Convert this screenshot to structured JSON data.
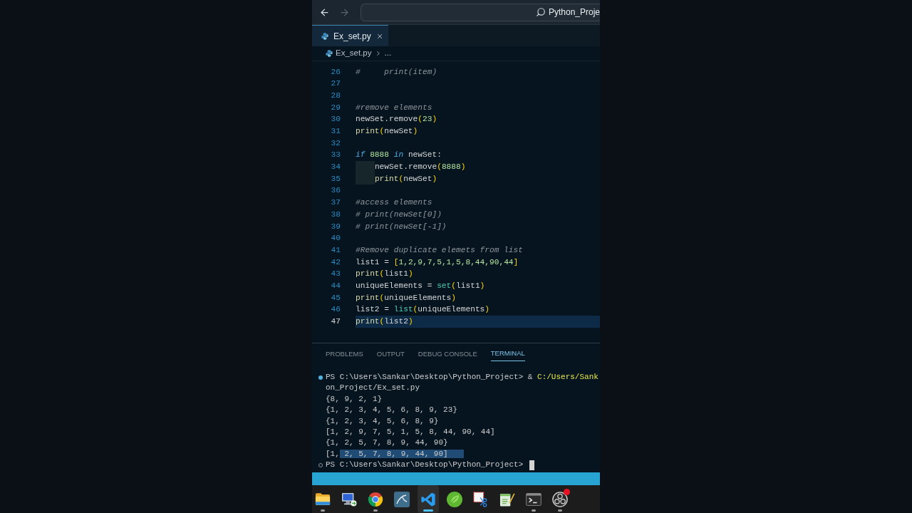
{
  "title_bar": {
    "back": {
      "disabled": false
    },
    "forward": {
      "disabled": true
    },
    "command_center": {
      "text": "Python_Proje"
    }
  },
  "tabs": [
    {
      "label": "Ex_set.py",
      "selected": true
    }
  ],
  "breadcrumb": [
    "Ex_set.py",
    "..."
  ],
  "editor": {
    "lines": [
      {
        "number": "26",
        "active": false,
        "indented": false,
        "tokens": [
          {
            "text": "#     print(item)",
            "kind": "comment"
          }
        ]
      },
      {
        "number": "27",
        "active": false,
        "indented": false
      },
      {
        "number": "28",
        "active": false,
        "indented": false
      },
      {
        "number": "29",
        "active": false,
        "indented": false,
        "tokens": [
          {
            "text": "#remove elements",
            "kind": "comment"
          }
        ]
      },
      {
        "number": "30",
        "active": false,
        "indented": false,
        "tokens": [
          {
            "text": "newSet.remove",
            "kind": "plain"
          },
          {
            "text": "(",
            "kind": "bracket"
          },
          {
            "text": "23",
            "kind": "number"
          },
          {
            "text": ")",
            "kind": "bracket"
          }
        ]
      },
      {
        "number": "31",
        "active": false,
        "indented": false,
        "tokens": [
          {
            "text": "print",
            "kind": "function"
          },
          {
            "text": "(",
            "kind": "bracket"
          },
          {
            "text": "newSet",
            "kind": "plain"
          },
          {
            "text": ")",
            "kind": "bracket"
          }
        ]
      },
      {
        "number": "32",
        "active": false,
        "indented": false
      },
      {
        "number": "33",
        "active": false,
        "indented": false,
        "tokens": [
          {
            "text": "if",
            "kind": "keyword"
          },
          {
            "text": " 8888",
            "kind": "number"
          },
          {
            "text": " in",
            "kind": "keyword"
          },
          {
            "text": " newSet:",
            "kind": "plain"
          }
        ]
      },
      {
        "number": "34",
        "active": false,
        "indented": true,
        "tokens": [
          {
            "text": "newSet.remove",
            "kind": "plain"
          },
          {
            "text": "(",
            "kind": "bracket"
          },
          {
            "text": "8888",
            "kind": "number"
          },
          {
            "text": ")",
            "kind": "bracket"
          }
        ]
      },
      {
        "number": "35",
        "active": false,
        "indented": true,
        "tokens": [
          {
            "text": "print",
            "kind": "function"
          },
          {
            "text": "(",
            "kind": "bracket"
          },
          {
            "text": "newSet",
            "kind": "plain"
          },
          {
            "text": ")",
            "kind": "bracket"
          }
        ]
      },
      {
        "number": "36",
        "active": false,
        "indented": false
      },
      {
        "number": "37",
        "active": false,
        "indented": false,
        "tokens": [
          {
            "text": "#access elements",
            "kind": "comment"
          }
        ]
      },
      {
        "number": "38",
        "active": false,
        "indented": false,
        "tokens": [
          {
            "text": "# print(newSet[0])",
            "kind": "comment"
          }
        ]
      },
      {
        "number": "39",
        "active": false,
        "indented": false,
        "tokens": [
          {
            "text": "# print(newSet[-1])",
            "kind": "comment"
          }
        ]
      },
      {
        "number": "40",
        "active": false,
        "indented": false
      },
      {
        "number": "41",
        "active": false,
        "indented": false,
        "tokens": [
          {
            "text": "#Remove duplicate elemets from list",
            "kind": "comment"
          }
        ]
      },
      {
        "number": "42",
        "active": false,
        "indented": false,
        "tokens": [
          {
            "text": "list1 ",
            "kind": "plain"
          },
          {
            "text": "= ",
            "kind": "operator"
          },
          {
            "text": "[",
            "kind": "bracket"
          },
          {
            "text": "1,2,9,7,5,1,5,8,44,90,44",
            "kind": "number"
          },
          {
            "text": "]",
            "kind": "bracket"
          }
        ]
      },
      {
        "number": "43",
        "active": false,
        "indented": false,
        "tokens": [
          {
            "text": "print",
            "kind": "function"
          },
          {
            "text": "(",
            "kind": "bracket"
          },
          {
            "text": "list1",
            "kind": "plain"
          },
          {
            "text": ")",
            "kind": "bracket"
          }
        ]
      },
      {
        "number": "44",
        "active": false,
        "indented": false,
        "tokens": [
          {
            "text": "uniqueElements ",
            "kind": "plain"
          },
          {
            "text": "= ",
            "kind": "operator"
          },
          {
            "text": "set",
            "kind": "builtin"
          },
          {
            "text": "(",
            "kind": "bracket"
          },
          {
            "text": "list1",
            "kind": "plain"
          },
          {
            "text": ")",
            "kind": "bracket"
          }
        ]
      },
      {
        "number": "45",
        "active": false,
        "indented": false,
        "tokens": [
          {
            "text": "print",
            "kind": "function"
          },
          {
            "text": "(",
            "kind": "bracket"
          },
          {
            "text": "uniqueElements",
            "kind": "plain"
          },
          {
            "text": ")",
            "kind": "bracket"
          }
        ]
      },
      {
        "number": "46",
        "active": false,
        "indented": false,
        "tokens": [
          {
            "text": "list2 ",
            "kind": "plain"
          },
          {
            "text": "= ",
            "kind": "operator"
          },
          {
            "text": "list",
            "kind": "builtin"
          },
          {
            "text": "(",
            "kind": "bracket"
          },
          {
            "text": "uniqueElements",
            "kind": "plain"
          },
          {
            "text": ")",
            "kind": "bracket"
          }
        ]
      },
      {
        "number": "47",
        "active": true,
        "indented": false,
        "tokens": [
          {
            "text": "print",
            "kind": "function"
          },
          {
            "text": "(",
            "kind": "bracket"
          },
          {
            "text": "list2",
            "kind": "plain"
          },
          {
            "text": ")",
            "kind": "bracket"
          }
        ]
      }
    ]
  },
  "panel": {
    "tabs": [
      {
        "label": "PROBLEMS",
        "selected": false
      },
      {
        "label": "OUTPUT",
        "selected": false
      },
      {
        "label": "DEBUG CONSOLE",
        "selected": false
      },
      {
        "label": "TERMINAL",
        "selected": true
      }
    ],
    "terminal": {
      "lines": [
        {
          "kind": "command",
          "cursor": false,
          "segments": [
            {
              "text": "PS C:\\Users\\Sankar\\Desktop\\Python_Project> & ",
              "kind": "plain",
              "selected": false
            },
            {
              "text": "C:/Users/Sank",
              "kind": "path",
              "selected": false
            }
          ]
        },
        {
          "kind": "output",
          "cursor": false,
          "segments": [
            {
              "text": "on_Project/Ex_set.py",
              "kind": "plain",
              "selected": false
            }
          ]
        },
        {
          "kind": "output",
          "cursor": false,
          "segments": [
            {
              "text": "{8, 9, 2, 1}",
              "kind": "plain",
              "selected": false
            }
          ]
        },
        {
          "kind": "output",
          "cursor": false,
          "segments": [
            {
              "text": "{1, 2, 3, 4, 5, 6, 8, 9, 23}",
              "kind": "plain",
              "selected": false
            }
          ]
        },
        {
          "kind": "output",
          "cursor": false,
          "segments": [
            {
              "text": "{1, 2, 3, 4, 5, 6, 8, 9}",
              "kind": "plain",
              "selected": false
            }
          ]
        },
        {
          "kind": "output",
          "cursor": false,
          "segments": [
            {
              "text": "[1, 2, 9, 7, 5, 1, 5, 8, 44, 90, 44]",
              "kind": "plain",
              "selected": false
            }
          ]
        },
        {
          "kind": "output",
          "cursor": false,
          "segments": [
            {
              "text": "{1, 2, 5, 7, 8, 9, 44, 90}",
              "kind": "plain",
              "selected": false
            }
          ]
        },
        {
          "kind": "output",
          "cursor": false,
          "segments": [
            {
              "text": "[1,",
              "kind": "plain",
              "selected": false
            },
            {
              "text": " 2, 5, 7, 8, 9, 44, 90]",
              "kind": "plain",
              "selected": true
            }
          ]
        },
        {
          "kind": "prompt",
          "cursor": true,
          "segments": [
            {
              "text": "PS C:\\Users\\Sankar\\Desktop\\Python_Project>",
              "kind": "plain",
              "selected": false
            }
          ]
        }
      ]
    }
  },
  "taskbar": {
    "items": [
      {
        "kind": "folder",
        "running": true,
        "active": false,
        "notification": false
      },
      {
        "kind": "monitor",
        "running": false,
        "active": false,
        "notification": false
      },
      {
        "kind": "browser",
        "running": true,
        "active": false,
        "notification": false
      },
      {
        "kind": "tile",
        "running": false,
        "active": false,
        "notification": false
      },
      {
        "kind": "editor",
        "running": true,
        "active": true,
        "notification": false
      },
      {
        "kind": "leaf",
        "running": false,
        "active": false,
        "notification": false
      },
      {
        "kind": "snip",
        "running": false,
        "active": false,
        "notification": false
      },
      {
        "kind": "notepad",
        "running": false,
        "active": false,
        "notification": false
      },
      {
        "kind": "terminal",
        "running": true,
        "active": false,
        "notification": false
      },
      {
        "kind": "recorder",
        "running": true,
        "active": false,
        "notification": true
      }
    ]
  }
}
